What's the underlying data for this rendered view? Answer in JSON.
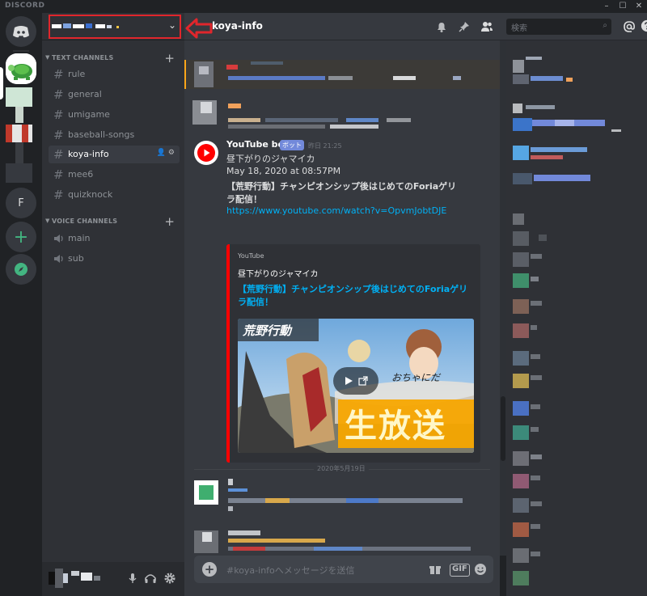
{
  "app": {
    "brand": "DISCORD"
  },
  "window": {
    "minimize": "–",
    "maximize": "☐",
    "close": "✕"
  },
  "guilds": {
    "f_label": "F",
    "add_label": "+"
  },
  "server": {
    "name_placeholder": ""
  },
  "sidebar": {
    "text_category": "TEXT CHANNELS",
    "voice_category": "VOICE CHANNELS",
    "text_channels": [
      {
        "name": "rule"
      },
      {
        "name": "general"
      },
      {
        "name": "umigame"
      },
      {
        "name": "baseball-songs"
      },
      {
        "name": "koya-info"
      },
      {
        "name": "mee6"
      },
      {
        "name": "quizknock"
      }
    ],
    "voice_channels": [
      {
        "name": "main"
      },
      {
        "name": "sub"
      }
    ]
  },
  "header": {
    "channel": "koya-info",
    "search_placeholder": "検索"
  },
  "message": {
    "author": "YouTube bot",
    "bot_tag": "ボット",
    "timestamp": "昨日 21:25",
    "lines": [
      "昼下がりのジャマイカ",
      "May 18, 2020 at 08:57PM",
      "【荒野行動】チャンピオンシップ後はじめてのForiaゲリ",
      "ラ配信！"
    ],
    "link": "https://www.youtube.com/watch?v=OpvmJobtDJE"
  },
  "embed": {
    "provider": "YouTube",
    "author": "昼下がりのジャマイカ",
    "title": "【荒野行動】チャンピオンシップ後はじめてのForiaゲリラ配信！",
    "thumb_logo": "荒野行動",
    "thumb_caption": "おちゃにだ",
    "thumb_banner": "生放送"
  },
  "divider": {
    "label": "2020年5月19日"
  },
  "composer": {
    "placeholder": "#koya-infoへメッセージを送信",
    "gif_label": "GIF"
  },
  "colors": {
    "accent": "#7289da",
    "link": "#00b0f4",
    "embed_bar": "#ff0000",
    "highlight": "#e0262c"
  }
}
